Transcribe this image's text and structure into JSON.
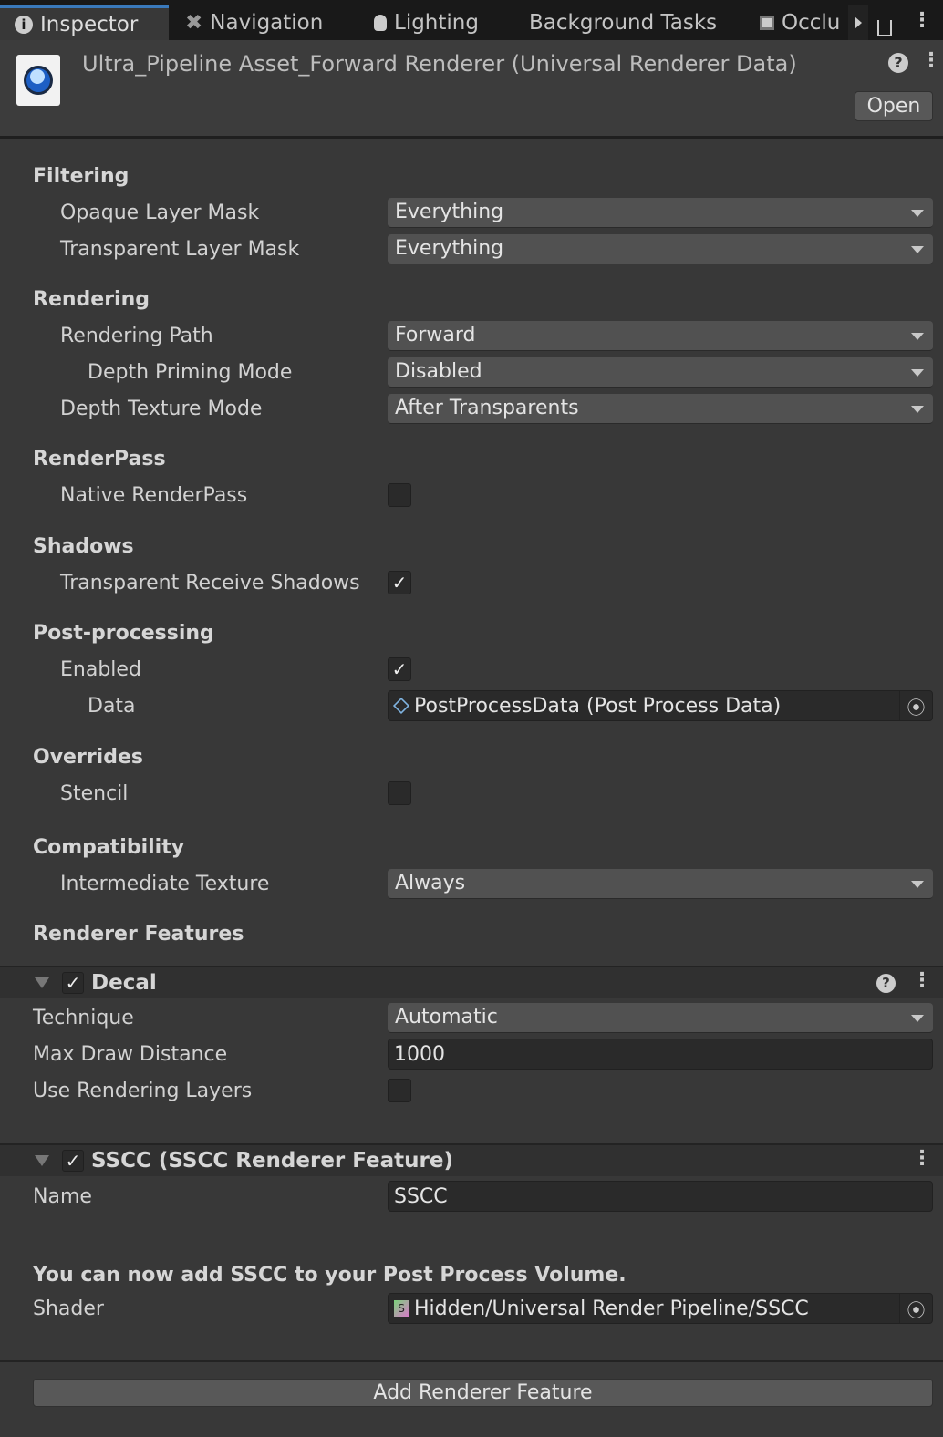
{
  "tabs": [
    {
      "label": "Inspector",
      "icon": "info-icon"
    },
    {
      "label": "Navigation",
      "icon": "navigation-icon"
    },
    {
      "label": "Lighting",
      "icon": "bulb-icon"
    },
    {
      "label": "Background Tasks"
    },
    {
      "label": "Occlu",
      "icon": "occlusion-icon"
    }
  ],
  "header": {
    "title": "Ultra_Pipeline Asset_Forward Renderer (Universal Renderer Data)",
    "open": "Open"
  },
  "sections": {
    "filtering": "Filtering",
    "rendering": "Rendering",
    "renderpass": "RenderPass",
    "shadows": "Shadows",
    "post": "Post-processing",
    "overrides": "Overrides",
    "compat": "Compatibility",
    "features": "Renderer Features"
  },
  "fields": {
    "opaque": {
      "label": "Opaque Layer Mask",
      "value": "Everything"
    },
    "transparent": {
      "label": "Transparent Layer Mask",
      "value": "Everything"
    },
    "path": {
      "label": "Rendering Path",
      "value": "Forward"
    },
    "priming": {
      "label": "Depth Priming Mode",
      "value": "Disabled"
    },
    "depthtex": {
      "label": "Depth Texture Mode",
      "value": "After Transparents"
    },
    "native": {
      "label": "Native RenderPass",
      "checked": false
    },
    "trs": {
      "label": "Transparent Receive Shadows",
      "checked": true
    },
    "enabled": {
      "label": "Enabled",
      "checked": true
    },
    "data": {
      "label": "Data",
      "value": "PostProcessData (Post Process Data)"
    },
    "stencil": {
      "label": "Stencil",
      "checked": false
    },
    "intermediate": {
      "label": "Intermediate Texture",
      "value": "Always"
    }
  },
  "decal": {
    "title": "Decal",
    "enabled": true,
    "technique": {
      "label": "Technique",
      "value": "Automatic"
    },
    "maxdist": {
      "label": "Max Draw Distance",
      "value": "1000"
    },
    "layers": {
      "label": "Use Rendering Layers",
      "checked": false
    }
  },
  "sscc": {
    "title": "SSCC (SSCC Renderer Feature)",
    "enabled": true,
    "name": {
      "label": "Name",
      "value": "SSCC"
    },
    "message": "You can now add SSCC to your Post Process Volume.",
    "shader": {
      "label": "Shader",
      "value": "Hidden/Universal Render Pipeline/SSCC"
    }
  },
  "add_feature": "Add Renderer Feature",
  "check_glyph": "✓"
}
